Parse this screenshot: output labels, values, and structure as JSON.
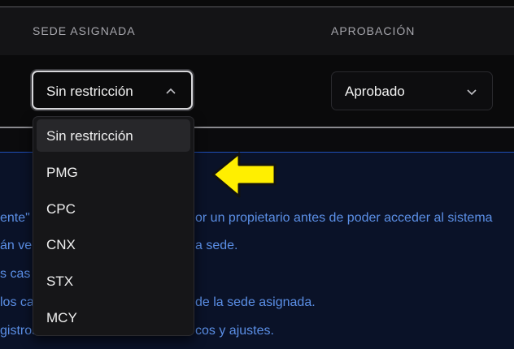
{
  "table": {
    "columns": {
      "sede": "SEDE ASIGNADA",
      "aprobacion": "APROBACIÓN"
    },
    "row": {
      "sede_value": "Sin restricción",
      "aprobacion_value": "Aprobado"
    }
  },
  "dropdown": {
    "options": [
      {
        "label": "Sin restricción"
      },
      {
        "label": "PMG"
      },
      {
        "label": "CPC"
      },
      {
        "label": "CNX"
      },
      {
        "label": "STX"
      },
      {
        "label": "MCY"
      }
    ]
  },
  "info": {
    "lines": [
      "ente\"",
      "or un propietario antes de poder acceder al sistema",
      "án ve",
      "a sede.",
      "s cas",
      "los ca",
      "de la sede asignada.",
      "gistros,",
      "cos y ajustes."
    ]
  },
  "colors": {
    "accent_blue": "#5b8fe6",
    "arrow_yellow": "#ffef00"
  }
}
